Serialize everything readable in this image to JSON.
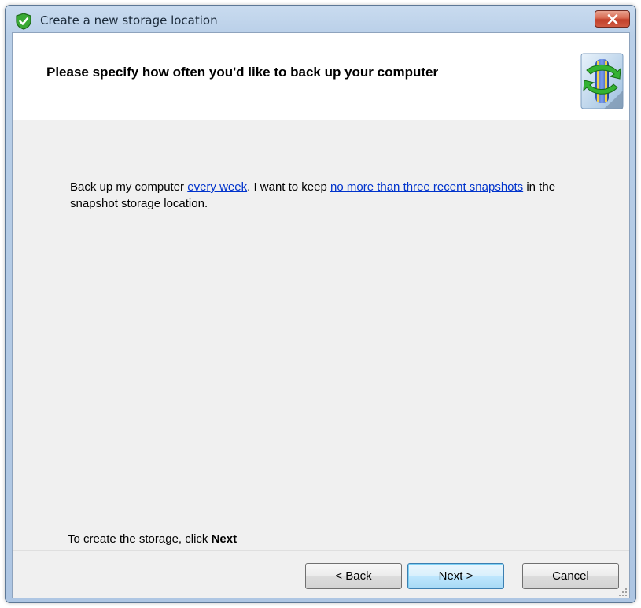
{
  "window": {
    "title": "Create a new storage location",
    "icon": "shield-check-icon",
    "close_icon": "close-icon"
  },
  "header": {
    "title": "Please specify how often you'd like to back up your computer",
    "icon": "backup-arrows-icon"
  },
  "body": {
    "text_1": "Back up my computer ",
    "link_frequency": "every week",
    "text_2": ". I want to keep ",
    "link_snapshots": "no more than three recent snapshots",
    "text_3": " in the snapshot storage location."
  },
  "footer_hint": {
    "text": "To create the storage, click ",
    "bold": "Next"
  },
  "buttons": {
    "back": "< Back",
    "next": "Next >",
    "cancel": "Cancel"
  },
  "colors": {
    "link": "#0033cc",
    "client_bg": "#f0f0f0",
    "frame": "#b9cfe8"
  }
}
